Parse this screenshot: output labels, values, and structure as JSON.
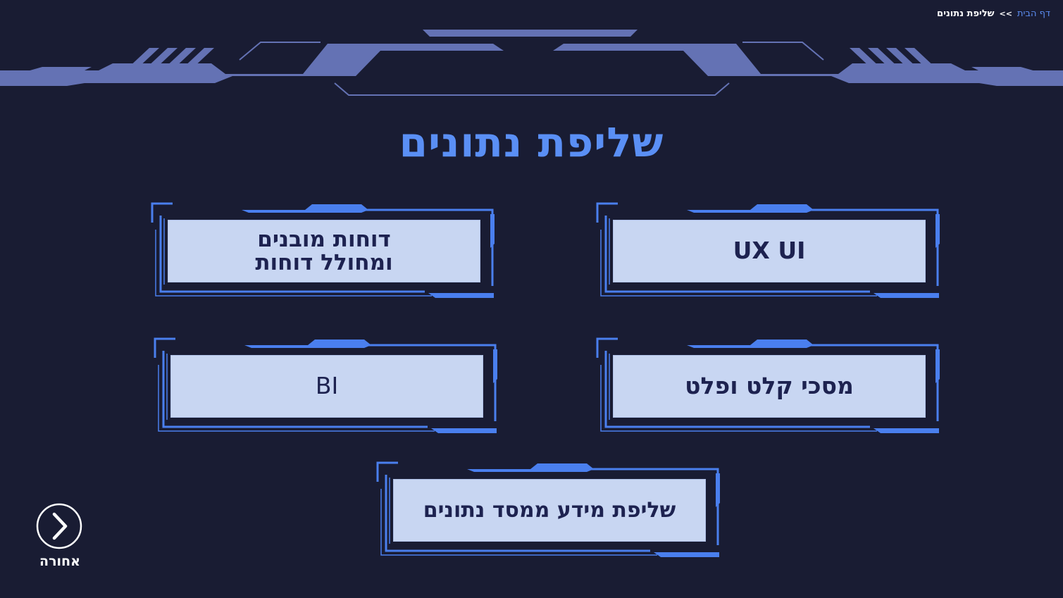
{
  "breadcrumb": {
    "home": "דף הבית",
    "separator": ">>",
    "current": "שליפת נתונים"
  },
  "title": "שליפת נתונים",
  "cards": {
    "reports": {
      "line1": "דוחות מובנים",
      "line2": "ומחולל דוחות"
    },
    "uxui": {
      "label": "UX UI"
    },
    "bi": {
      "label": "BI"
    },
    "io_screens": {
      "label": "מסכי קלט ופלט"
    },
    "db_query": {
      "label": "שליפת מידע ממסד נתונים"
    }
  },
  "back": {
    "label": "אחורה",
    "icon": "chevron-right-icon"
  },
  "colors": {
    "background": "#191c33",
    "accent": "#5a8ff5",
    "frame": "#4a7fee",
    "deco": "#6472b4",
    "card_face": "#c8d6f2",
    "card_text": "#1d2250"
  }
}
